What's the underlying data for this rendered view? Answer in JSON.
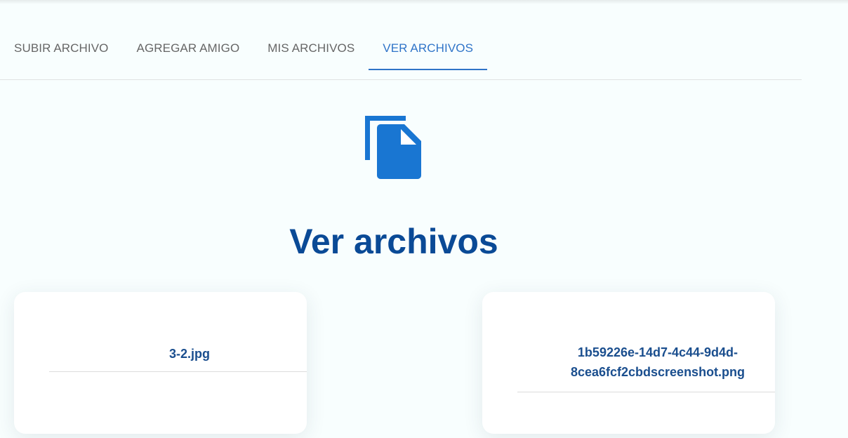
{
  "tabs": [
    {
      "label": "SUBIR ARCHIVO",
      "active": false
    },
    {
      "label": "AGREGAR AMIGO",
      "active": false
    },
    {
      "label": "MIS ARCHIVOS",
      "active": false
    },
    {
      "label": "VER ARCHIVOS",
      "active": true
    }
  ],
  "hero": {
    "icon": "file-copy-icon",
    "color": "#1976d2"
  },
  "page_title": "Ver archivos",
  "files": [
    {
      "name": "3-2.jpg"
    },
    {
      "name_line1": "1b59226e-14d7-4c44-9d4d-",
      "name_line2": "8cea6fcf2cbdscreenshot.png"
    }
  ],
  "colors": {
    "accent": "#2f74c8",
    "title": "#0a4a96",
    "file_name": "#1a4e8e",
    "background": "#f8fefe"
  }
}
